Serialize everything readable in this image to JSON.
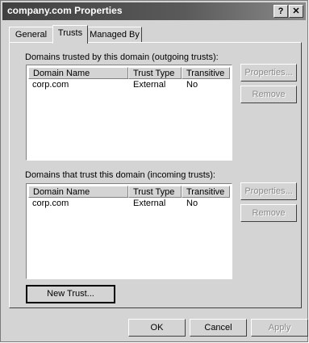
{
  "window": {
    "title": "company.com Properties",
    "help_button": "?",
    "close_button": "X"
  },
  "tabs": [
    {
      "label": "General",
      "active": false
    },
    {
      "label": "Trusts",
      "active": true
    },
    {
      "label": "Managed By",
      "active": false
    }
  ],
  "outgoing": {
    "label": "Domains trusted by this domain (outgoing trusts):",
    "columns": [
      "Domain Name",
      "Trust Type",
      "Transitive"
    ],
    "rows": [
      {
        "domain": "corp.com",
        "type": "External",
        "transitive": "No"
      }
    ],
    "properties_button": "Properties...",
    "remove_button": "Remove"
  },
  "incoming": {
    "label": "Domains that trust this domain (incoming trusts):",
    "columns": [
      "Domain Name",
      "Trust Type",
      "Transitive"
    ],
    "rows": [
      {
        "domain": "corp.com",
        "type": "External",
        "transitive": "No"
      }
    ],
    "properties_button": "Properties...",
    "remove_button": "Remove"
  },
  "new_trust_button": "New Trust...",
  "footer": {
    "ok": "OK",
    "cancel": "Cancel",
    "apply": "Apply"
  }
}
